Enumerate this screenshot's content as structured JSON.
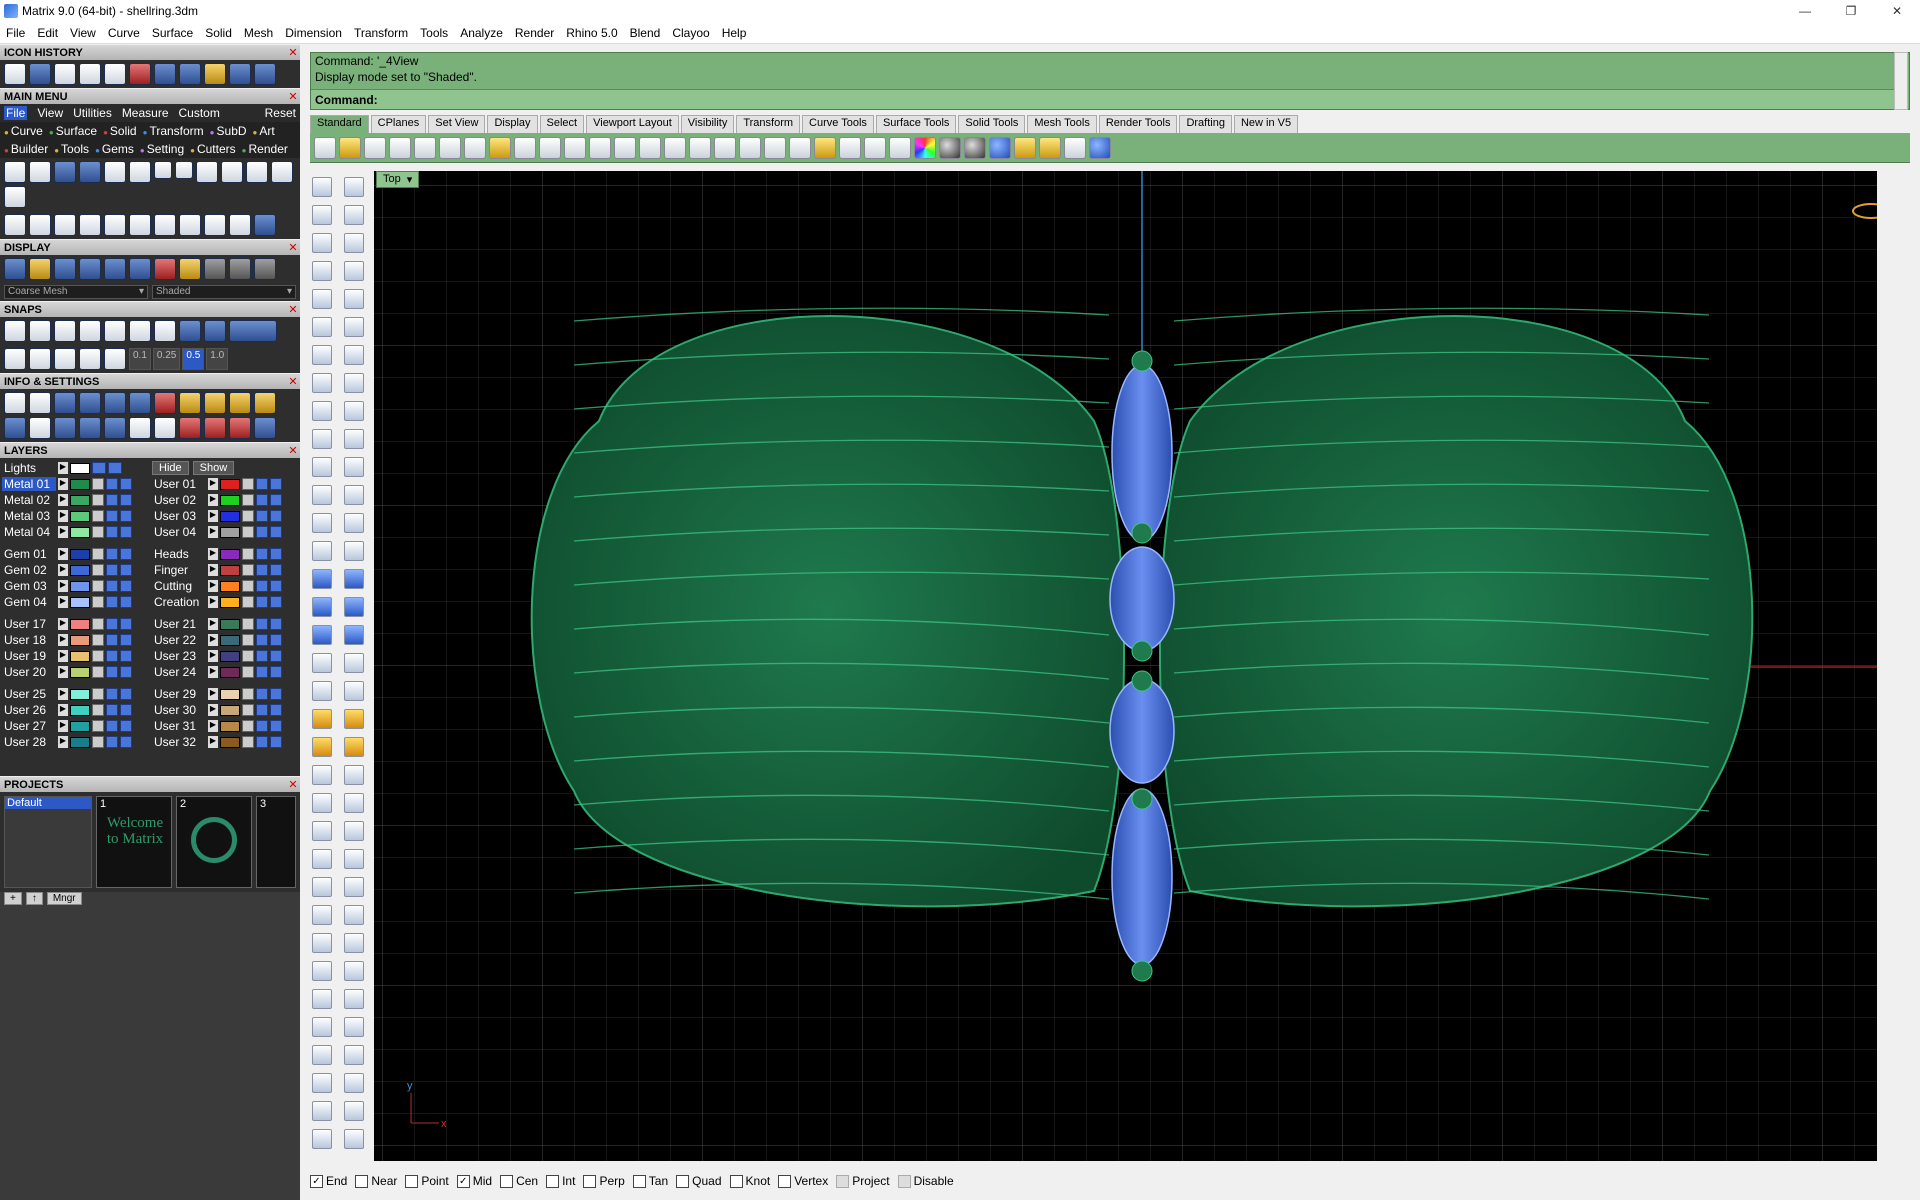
{
  "window": {
    "title": "Matrix 9.0 (64-bit) - shellring.3dm",
    "controls": [
      "—",
      "❐",
      "✕"
    ]
  },
  "menu": [
    "File",
    "Edit",
    "View",
    "Curve",
    "Surface",
    "Solid",
    "Mesh",
    "Dimension",
    "Transform",
    "Tools",
    "Analyze",
    "Render",
    "Rhino 5.0",
    "Blend",
    "Clayoo",
    "Help"
  ],
  "panels": {
    "icon_history": "ICON HISTORY",
    "main_menu": "MAIN MENU",
    "display": "DISPLAY",
    "snaps": "SNAPS",
    "info_settings": "INFO & SETTINGS",
    "layers": "LAYERS",
    "projects": "PROJECTS"
  },
  "main_menu": {
    "tabs": [
      "File",
      "View",
      "Utilities",
      "Measure",
      "Custom"
    ],
    "reset": "Reset",
    "sub1": [
      "Curve",
      "Surface",
      "Solid",
      "Transform",
      "SubD",
      "Art"
    ],
    "sub2": [
      "Builder",
      "Tools",
      "Gems",
      "Setting",
      "Cutters",
      "Render"
    ]
  },
  "display": {
    "mesh": "Coarse Mesh",
    "mode": "Shaded"
  },
  "snaps": {
    "values": [
      "0.1",
      "0.25",
      "0.5",
      "1.0"
    ],
    "active": "0.5"
  },
  "layers": {
    "lights": "Lights",
    "hide": "Hide",
    "show": "Show",
    "left": [
      {
        "name": "Metal 01",
        "color": "#1e8a4c",
        "selected": true
      },
      {
        "name": "Metal 02",
        "color": "#3aa860"
      },
      {
        "name": "Metal 03",
        "color": "#5cc97a"
      },
      {
        "name": "Metal 04",
        "color": "#8fe8a0"
      },
      {
        "name": "Gem 01",
        "color": "#1a3fa8"
      },
      {
        "name": "Gem 02",
        "color": "#3d6ad8"
      },
      {
        "name": "Gem 03",
        "color": "#6f95ee"
      },
      {
        "name": "Gem 04",
        "color": "#a7c3ff"
      },
      {
        "name": "User 17",
        "color": "#f08080"
      },
      {
        "name": "User 18",
        "color": "#e89a7a"
      },
      {
        "name": "User 19",
        "color": "#e8c070"
      },
      {
        "name": "User 20",
        "color": "#b8d070"
      },
      {
        "name": "User 25",
        "color": "#80f0d8"
      },
      {
        "name": "User 26",
        "color": "#40d0c0"
      },
      {
        "name": "User 27",
        "color": "#20a0a0"
      },
      {
        "name": "User 28",
        "color": "#1a7e8a"
      }
    ],
    "right": [
      {
        "name": "User 01",
        "color": "#e02020"
      },
      {
        "name": "User 02",
        "color": "#20d020"
      },
      {
        "name": "User 03",
        "color": "#2030e0"
      },
      {
        "name": "User 04",
        "color": "#a0a0a0"
      },
      {
        "name": "Heads",
        "color": "#8a2ab8"
      },
      {
        "name": "Finger",
        "color": "#c04040"
      },
      {
        "name": "Cutting",
        "color": "#ff8020"
      },
      {
        "name": "Creation",
        "color": "#ffb020"
      },
      {
        "name": "User 21",
        "color": "#3a7a5a"
      },
      {
        "name": "User 22",
        "color": "#3a6a7a"
      },
      {
        "name": "User 23",
        "color": "#404080"
      },
      {
        "name": "User 24",
        "color": "#702a5a"
      },
      {
        "name": "User 29",
        "color": "#e8d0b0"
      },
      {
        "name": "User 30",
        "color": "#c8a878"
      },
      {
        "name": "User 31",
        "color": "#b88848"
      },
      {
        "name": "User 32",
        "color": "#8a5a20"
      }
    ]
  },
  "projects": {
    "default": "Default",
    "thumbs": [
      "1",
      "2",
      "3"
    ],
    "welcome": "Welcome to Matrix",
    "mngr": "Mngr"
  },
  "command": {
    "line1": "Command: '_4View",
    "line2": "Display mode set to \"Shaded\".",
    "prompt": "Command:"
  },
  "tabs": [
    "Standard",
    "CPlanes",
    "Set View",
    "Display",
    "Select",
    "Viewport Layout",
    "Visibility",
    "Transform",
    "Curve Tools",
    "Surface Tools",
    "Solid Tools",
    "Mesh Tools",
    "Render Tools",
    "Drafting",
    "New in V5"
  ],
  "viewport": {
    "name": "Top",
    "axis_y": "y",
    "axis_x": "x"
  },
  "osnaps": [
    {
      "label": "End",
      "checked": true
    },
    {
      "label": "Near",
      "checked": false
    },
    {
      "label": "Point",
      "checked": false
    },
    {
      "label": "Mid",
      "checked": true
    },
    {
      "label": "Cen",
      "checked": false
    },
    {
      "label": "Int",
      "checked": false
    },
    {
      "label": "Perp",
      "checked": false
    },
    {
      "label": "Tan",
      "checked": false
    },
    {
      "label": "Quad",
      "checked": false
    },
    {
      "label": "Knot",
      "checked": false
    },
    {
      "label": "Vertex",
      "checked": false
    },
    {
      "label": "Project",
      "checked": false,
      "disabled": true
    },
    {
      "label": "Disable",
      "checked": false,
      "disabled": true
    }
  ]
}
